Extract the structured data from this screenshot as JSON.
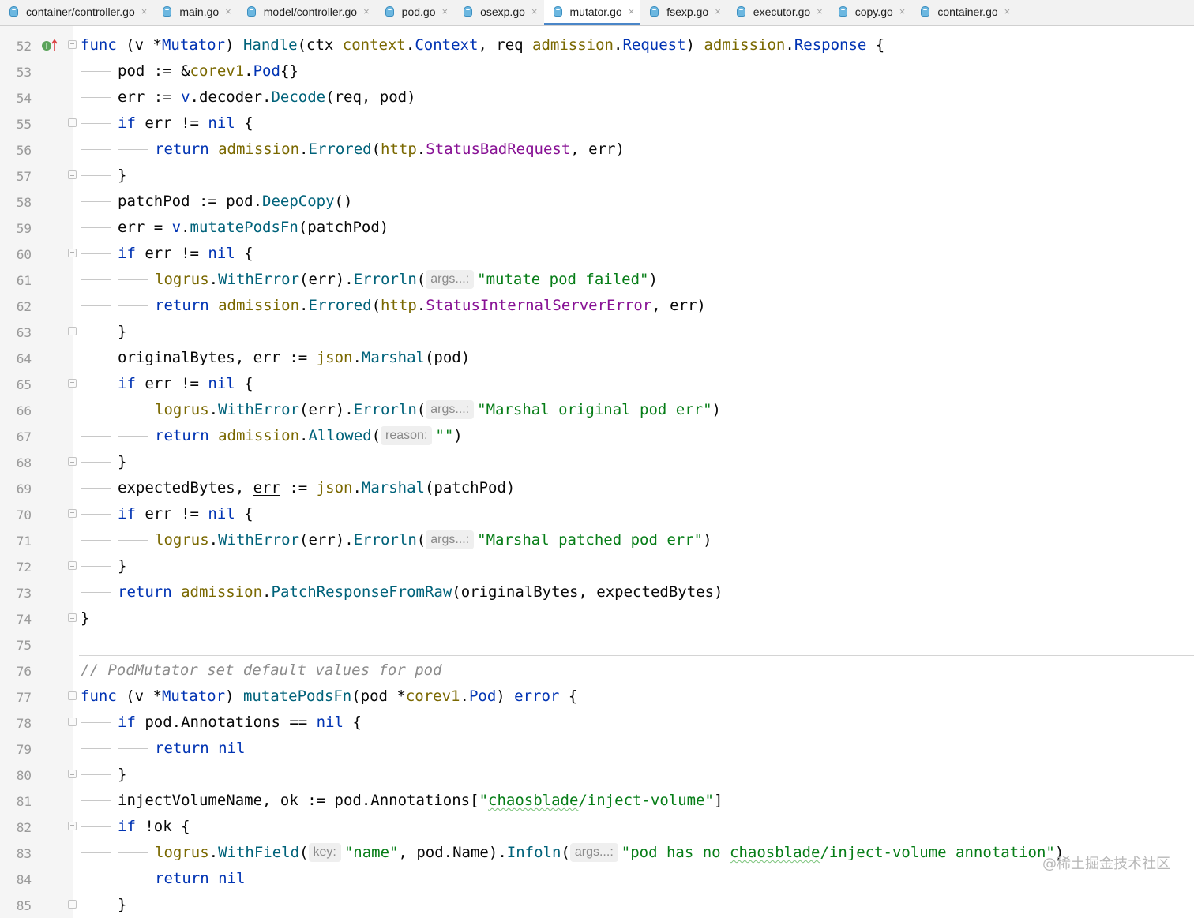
{
  "tabs": [
    {
      "label": "container/controller.go",
      "active": false
    },
    {
      "label": "main.go",
      "active": false
    },
    {
      "label": "model/controller.go",
      "active": false
    },
    {
      "label": "pod.go",
      "active": false
    },
    {
      "label": "osexp.go",
      "active": false
    },
    {
      "label": "mutator.go",
      "active": true
    },
    {
      "label": "fsexp.go",
      "active": false
    },
    {
      "label": "executor.go",
      "active": false
    },
    {
      "label": "copy.go",
      "active": false
    },
    {
      "label": "container.go",
      "active": false
    }
  ],
  "tab_close_glyph": "×",
  "gutter_icons": {
    "line_52": "implements-method-icon"
  },
  "colors": {
    "keyword": "#0033b3",
    "package": "#7a6800",
    "function": "#00627a",
    "constant": "#871094",
    "string": "#067d17",
    "comment": "#8c8c8c",
    "active_tab_underline": "#4a86c8"
  },
  "lines": [
    {
      "n": "52",
      "indent": 0,
      "fold": "down",
      "tokens": [
        [
          "func",
          "kw"
        ],
        [
          " (v *",
          ""
        ],
        [
          "Mutator",
          "ty"
        ],
        [
          ") ",
          ""
        ],
        [
          "Handle",
          "fnd"
        ],
        [
          "(ctx ",
          ""
        ],
        [
          "context",
          "pkg"
        ],
        [
          ".",
          ""
        ],
        [
          "Context",
          "ty"
        ],
        [
          ", req ",
          ""
        ],
        [
          "admission",
          "pkg"
        ],
        [
          ".",
          ""
        ],
        [
          "Request",
          "ty"
        ],
        [
          ") ",
          ""
        ],
        [
          "admission",
          "pkg"
        ],
        [
          ".",
          ""
        ],
        [
          "Response",
          "ty"
        ],
        [
          " {",
          ""
        ]
      ]
    },
    {
      "n": "53",
      "indent": 1,
      "fold": "",
      "tokens": [
        [
          "pod := &",
          ""
        ],
        [
          "corev1",
          "pkg"
        ],
        [
          ".",
          ""
        ],
        [
          "Pod",
          "ty"
        ],
        [
          "{}",
          ""
        ]
      ]
    },
    {
      "n": "54",
      "indent": 1,
      "fold": "",
      "tokens": [
        [
          "err := ",
          ""
        ],
        [
          "v",
          "kw"
        ],
        [
          ".decoder.",
          ""
        ],
        [
          "Decode",
          "fn"
        ],
        [
          "(req, pod)",
          ""
        ]
      ]
    },
    {
      "n": "55",
      "indent": 1,
      "fold": "down",
      "tokens": [
        [
          "if",
          "kw"
        ],
        [
          " err != ",
          ""
        ],
        [
          "nil",
          "kw"
        ],
        [
          " {",
          ""
        ]
      ]
    },
    {
      "n": "56",
      "indent": 2,
      "fold": "",
      "tokens": [
        [
          "return",
          "kw"
        ],
        [
          " ",
          ""
        ],
        [
          "admission",
          "pkg"
        ],
        [
          ".",
          ""
        ],
        [
          "Errored",
          "fn"
        ],
        [
          "(",
          ""
        ],
        [
          "http",
          "pkg"
        ],
        [
          ".",
          ""
        ],
        [
          "StatusBadRequest",
          "const"
        ],
        [
          ", err)",
          ""
        ]
      ]
    },
    {
      "n": "57",
      "indent": 1,
      "fold": "up",
      "tokens": [
        [
          "}",
          ""
        ]
      ]
    },
    {
      "n": "58",
      "indent": 1,
      "fold": "",
      "tokens": [
        [
          "patchPod := pod.",
          ""
        ],
        [
          "DeepCopy",
          "fn"
        ],
        [
          "()",
          ""
        ]
      ]
    },
    {
      "n": "59",
      "indent": 1,
      "fold": "",
      "tokens": [
        [
          "err = ",
          ""
        ],
        [
          "v",
          "kw"
        ],
        [
          ".",
          ""
        ],
        [
          "mutatePodsFn",
          "fn"
        ],
        [
          "(patchPod)",
          ""
        ]
      ]
    },
    {
      "n": "60",
      "indent": 1,
      "fold": "down",
      "tokens": [
        [
          "if",
          "kw"
        ],
        [
          " err != ",
          ""
        ],
        [
          "nil",
          "kw"
        ],
        [
          " {",
          ""
        ]
      ]
    },
    {
      "n": "61",
      "indent": 2,
      "fold": "",
      "tokens": [
        [
          "logrus",
          "pkg"
        ],
        [
          ".",
          ""
        ],
        [
          "WithError",
          "fn"
        ],
        [
          "(err).",
          ""
        ],
        [
          "Errorln",
          "fn"
        ],
        [
          "(",
          ""
        ],
        [
          "args...:",
          "hint"
        ],
        [
          "\"mutate pod failed\"",
          "str"
        ],
        [
          ")",
          ""
        ]
      ]
    },
    {
      "n": "62",
      "indent": 2,
      "fold": "",
      "tokens": [
        [
          "return",
          "kw"
        ],
        [
          " ",
          ""
        ],
        [
          "admission",
          "pkg"
        ],
        [
          ".",
          ""
        ],
        [
          "Errored",
          "fn"
        ],
        [
          "(",
          ""
        ],
        [
          "http",
          "pkg"
        ],
        [
          ".",
          ""
        ],
        [
          "StatusInternalServerError",
          "const"
        ],
        [
          ", err)",
          ""
        ]
      ]
    },
    {
      "n": "63",
      "indent": 1,
      "fold": "up",
      "tokens": [
        [
          "}",
          ""
        ]
      ]
    },
    {
      "n": "64",
      "indent": 1,
      "fold": "",
      "tokens": [
        [
          "originalBytes, ",
          ""
        ],
        [
          "err",
          "ul"
        ],
        [
          " := ",
          ""
        ],
        [
          "json",
          "pkg"
        ],
        [
          ".",
          ""
        ],
        [
          "Marshal",
          "fn"
        ],
        [
          "(pod)",
          ""
        ]
      ]
    },
    {
      "n": "65",
      "indent": 1,
      "fold": "down",
      "tokens": [
        [
          "if",
          "kw"
        ],
        [
          " err != ",
          ""
        ],
        [
          "nil",
          "kw"
        ],
        [
          " {",
          ""
        ]
      ]
    },
    {
      "n": "66",
      "indent": 2,
      "fold": "",
      "tokens": [
        [
          "logrus",
          "pkg"
        ],
        [
          ".",
          ""
        ],
        [
          "WithError",
          "fn"
        ],
        [
          "(err).",
          ""
        ],
        [
          "Errorln",
          "fn"
        ],
        [
          "(",
          ""
        ],
        [
          "args...:",
          "hint"
        ],
        [
          "\"Marshal original pod err\"",
          "str"
        ],
        [
          ")",
          ""
        ]
      ]
    },
    {
      "n": "67",
      "indent": 2,
      "fold": "",
      "tokens": [
        [
          "return",
          "kw"
        ],
        [
          " ",
          ""
        ],
        [
          "admission",
          "pkg"
        ],
        [
          ".",
          ""
        ],
        [
          "Allowed",
          "fn"
        ],
        [
          "(",
          ""
        ],
        [
          "reason:",
          "hint"
        ],
        [
          "\"\"",
          "str"
        ],
        [
          ")",
          ""
        ]
      ]
    },
    {
      "n": "68",
      "indent": 1,
      "fold": "up",
      "tokens": [
        [
          "}",
          ""
        ]
      ]
    },
    {
      "n": "69",
      "indent": 1,
      "fold": "",
      "tokens": [
        [
          "expectedBytes, ",
          ""
        ],
        [
          "err",
          "ul"
        ],
        [
          " := ",
          ""
        ],
        [
          "json",
          "pkg"
        ],
        [
          ".",
          ""
        ],
        [
          "Marshal",
          "fn"
        ],
        [
          "(patchPod)",
          ""
        ]
      ]
    },
    {
      "n": "70",
      "indent": 1,
      "fold": "down",
      "tokens": [
        [
          "if",
          "kw"
        ],
        [
          " err != ",
          ""
        ],
        [
          "nil",
          "kw"
        ],
        [
          " {",
          ""
        ]
      ]
    },
    {
      "n": "71",
      "indent": 2,
      "fold": "",
      "tokens": [
        [
          "logrus",
          "pkg"
        ],
        [
          ".",
          ""
        ],
        [
          "WithError",
          "fn"
        ],
        [
          "(err).",
          ""
        ],
        [
          "Errorln",
          "fn"
        ],
        [
          "(",
          ""
        ],
        [
          "args...:",
          "hint"
        ],
        [
          "\"Marshal patched pod err\"",
          "str"
        ],
        [
          ")",
          ""
        ]
      ]
    },
    {
      "n": "72",
      "indent": 1,
      "fold": "up",
      "tokens": [
        [
          "}",
          ""
        ]
      ]
    },
    {
      "n": "73",
      "indent": 1,
      "fold": "",
      "tokens": [
        [
          "return",
          "kw"
        ],
        [
          " ",
          ""
        ],
        [
          "admission",
          "pkg"
        ],
        [
          ".",
          ""
        ],
        [
          "PatchResponseFromRaw",
          "fn"
        ],
        [
          "(originalBytes, expectedBytes)",
          ""
        ]
      ]
    },
    {
      "n": "74",
      "indent": 0,
      "fold": "up",
      "tokens": [
        [
          "}",
          ""
        ]
      ]
    },
    {
      "n": "75",
      "indent": 0,
      "fold": "",
      "tokens": []
    },
    {
      "n": "76",
      "indent": 0,
      "fold": "",
      "tokens": [
        [
          "// PodMutator set default values for pod",
          "cmt"
        ]
      ]
    },
    {
      "n": "77",
      "indent": 0,
      "fold": "down",
      "tokens": [
        [
          "func",
          "kw"
        ],
        [
          " (v *",
          ""
        ],
        [
          "Mutator",
          "ty"
        ],
        [
          ") ",
          ""
        ],
        [
          "mutatePodsFn",
          "fnd"
        ],
        [
          "(pod *",
          ""
        ],
        [
          "corev1",
          "pkg"
        ],
        [
          ".",
          ""
        ],
        [
          "Pod",
          "ty"
        ],
        [
          ") ",
          ""
        ],
        [
          "error",
          "kw"
        ],
        [
          " {",
          ""
        ]
      ]
    },
    {
      "n": "78",
      "indent": 1,
      "fold": "down",
      "tokens": [
        [
          "if",
          "kw"
        ],
        [
          " pod.Annotations == ",
          ""
        ],
        [
          "nil",
          "kw"
        ],
        [
          " {",
          ""
        ]
      ]
    },
    {
      "n": "79",
      "indent": 2,
      "fold": "",
      "tokens": [
        [
          "return",
          "kw"
        ],
        [
          " ",
          ""
        ],
        [
          "nil",
          "kw"
        ]
      ]
    },
    {
      "n": "80",
      "indent": 1,
      "fold": "up",
      "tokens": [
        [
          "}",
          ""
        ]
      ]
    },
    {
      "n": "81",
      "indent": 1,
      "fold": "",
      "tokens": [
        [
          "injectVolumeName, ok := pod.Annotations[",
          ""
        ],
        [
          "\"",
          "str"
        ],
        [
          "chaosblade",
          "str sq"
        ],
        [
          "/inject-volume\"",
          "str"
        ],
        [
          "]",
          ""
        ]
      ]
    },
    {
      "n": "82",
      "indent": 1,
      "fold": "down",
      "tokens": [
        [
          "if",
          "kw"
        ],
        [
          " !ok {",
          ""
        ]
      ]
    },
    {
      "n": "83",
      "indent": 2,
      "fold": "",
      "tokens": [
        [
          "logrus",
          "pkg"
        ],
        [
          ".",
          ""
        ],
        [
          "WithField",
          "fn"
        ],
        [
          "(",
          ""
        ],
        [
          "key:",
          "hint"
        ],
        [
          "\"name\"",
          "str"
        ],
        [
          ", pod.Name).",
          ""
        ],
        [
          "Infoln",
          "fn"
        ],
        [
          "(",
          ""
        ],
        [
          "args...:",
          "hint"
        ],
        [
          "\"pod has no ",
          "str"
        ],
        [
          "chaosblade",
          "str sq"
        ],
        [
          "/inject-volume annotation\"",
          "str"
        ],
        [
          ")",
          ""
        ]
      ]
    },
    {
      "n": "84",
      "indent": 2,
      "fold": "",
      "tokens": [
        [
          "return",
          "kw"
        ],
        [
          " ",
          ""
        ],
        [
          "nil",
          "kw"
        ]
      ]
    },
    {
      "n": "85",
      "indent": 1,
      "fold": "up",
      "tokens": [
        [
          "}",
          ""
        ]
      ]
    }
  ],
  "watermark": "@稀土掘金技术社区"
}
